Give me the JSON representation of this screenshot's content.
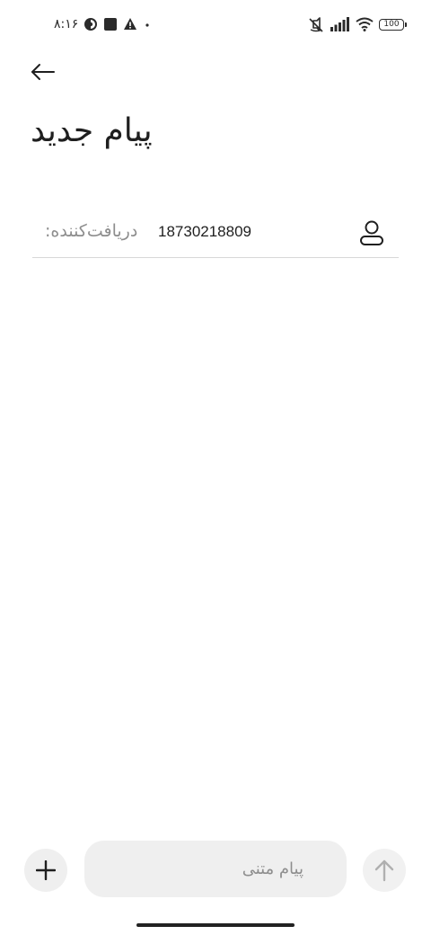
{
  "status_bar": {
    "time": "۸:۱۶",
    "battery": "100",
    "icons": [
      "vpn-icon",
      "app-icon",
      "alert-icon",
      "dot-icon",
      "mute-icon",
      "signal-icon",
      "wifi-icon",
      "battery-icon"
    ]
  },
  "header": {
    "back_icon": "arrow-left-icon",
    "title": "پیام جدید"
  },
  "recipient": {
    "label": "دریافت‌کننده:",
    "value": "18730218809",
    "contact_icon": "person-icon"
  },
  "compose": {
    "add_icon": "plus-icon",
    "placeholder": "پیام متنی",
    "value": "",
    "send_icon": "arrow-up-icon"
  },
  "colors": {
    "background": "#ffffff",
    "text": "#1f1f1f",
    "muted_text": "#8e8e8e",
    "input_bg": "#efefef",
    "divider": "#d8d8d8",
    "send_disabled": "#b0b0b0"
  }
}
